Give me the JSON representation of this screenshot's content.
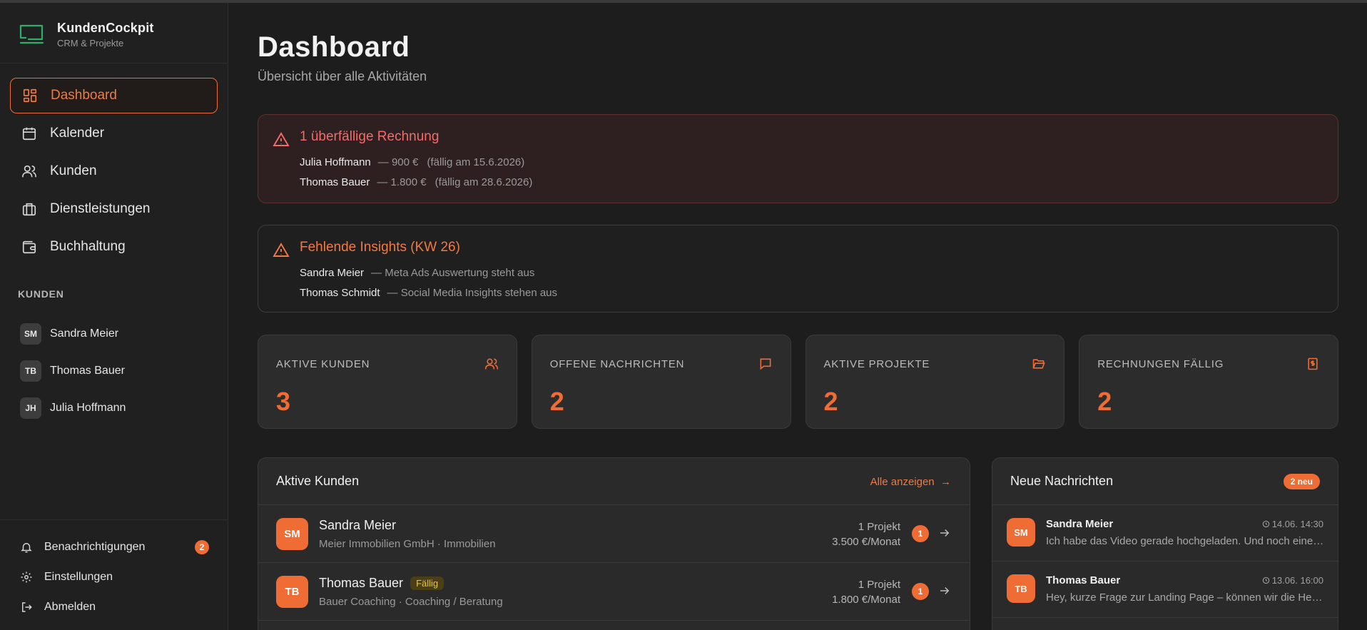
{
  "colors": {
    "accent": "#ef6c35",
    "danger": "#f36b6b",
    "warning_badge": "#e8c34c"
  },
  "brand": {
    "name": "KundenCockpit",
    "subtitle": "CRM & Projekte",
    "logo_icon": "chat-bubble-logo"
  },
  "nav": [
    {
      "label": "Dashboard",
      "icon": "dashboard-grid-icon",
      "active": true
    },
    {
      "label": "Kalender",
      "icon": "calendar-icon"
    },
    {
      "label": "Kunden",
      "icon": "users-icon"
    },
    {
      "label": "Dienstleistungen",
      "icon": "briefcase-icon"
    },
    {
      "label": "Buchhaltung",
      "icon": "wallet-icon"
    }
  ],
  "sidebar_clients": {
    "label": "KUNDEN",
    "items": [
      {
        "initials": "SM",
        "name": "Sandra Meier"
      },
      {
        "initials": "TB",
        "name": "Thomas Bauer"
      },
      {
        "initials": "JH",
        "name": "Julia Hoffmann"
      }
    ]
  },
  "sidebar_bottom": {
    "notifications": {
      "label": "Benachrichtigungen",
      "count": "2"
    },
    "settings": {
      "label": "Einstellungen"
    },
    "logout": {
      "label": "Abmelden"
    }
  },
  "header": {
    "title": "Dashboard",
    "subtitle": "Übersicht über alle Aktivitäten"
  },
  "alert_invoices": {
    "title": "1 überfällige Rechnung",
    "rows": [
      {
        "name": "Julia Hoffmann",
        "detail": "— 900 €",
        "due": "(fällig am 15.6.2026)"
      },
      {
        "name": "Thomas Bauer",
        "detail": "— 1.800 €",
        "due": "(fällig am 28.6.2026)"
      }
    ]
  },
  "alert_insights": {
    "title": "Fehlende Insights (KW 26)",
    "rows": [
      {
        "name": "Sandra Meier",
        "detail": "— Meta Ads Auswertung steht aus"
      },
      {
        "name": "Thomas Schmidt",
        "detail": "— Social Media Insights stehen aus"
      }
    ]
  },
  "stats": [
    {
      "label": "AKTIVE KUNDEN",
      "value": "3",
      "icon": "users-icon"
    },
    {
      "label": "OFFENE NACHRICHTEN",
      "value": "2",
      "icon": "message-icon"
    },
    {
      "label": "AKTIVE PROJEKTE",
      "value": "2",
      "icon": "folder-icon"
    },
    {
      "label": "RECHNUNGEN FÄLLIG",
      "value": "2",
      "icon": "invoice-icon"
    }
  ],
  "active_clients": {
    "title": "Aktive Kunden",
    "link": "Alle anzeigen",
    "rows": [
      {
        "initials": "SM",
        "name": "Sandra Meier",
        "tag": "",
        "sub": "Meier Immobilien GmbH · Immobilien",
        "projects": "1 Projekt",
        "revenue": "3.500 €/Monat",
        "count": "1"
      },
      {
        "initials": "TB",
        "name": "Thomas Bauer",
        "tag": "Fällig",
        "sub": "Bauer Coaching · Coaching / Beratung",
        "projects": "1 Projekt",
        "revenue": "1.800 €/Monat",
        "count": "1"
      }
    ]
  },
  "messages": {
    "title": "Neue Nachrichten",
    "badge": "2 neu",
    "rows": [
      {
        "initials": "SM",
        "name": "Sandra Meier",
        "time": "14.06. 14:30",
        "text": "Ich habe das Video gerade hochgeladen. Und noch eine Frage zum Schnitt"
      },
      {
        "initials": "TB",
        "name": "Thomas Bauer",
        "time": "13.06. 16:00",
        "text": "Hey, kurze Frage zur Landing Page – können wir die Headline anpassen?"
      }
    ]
  }
}
